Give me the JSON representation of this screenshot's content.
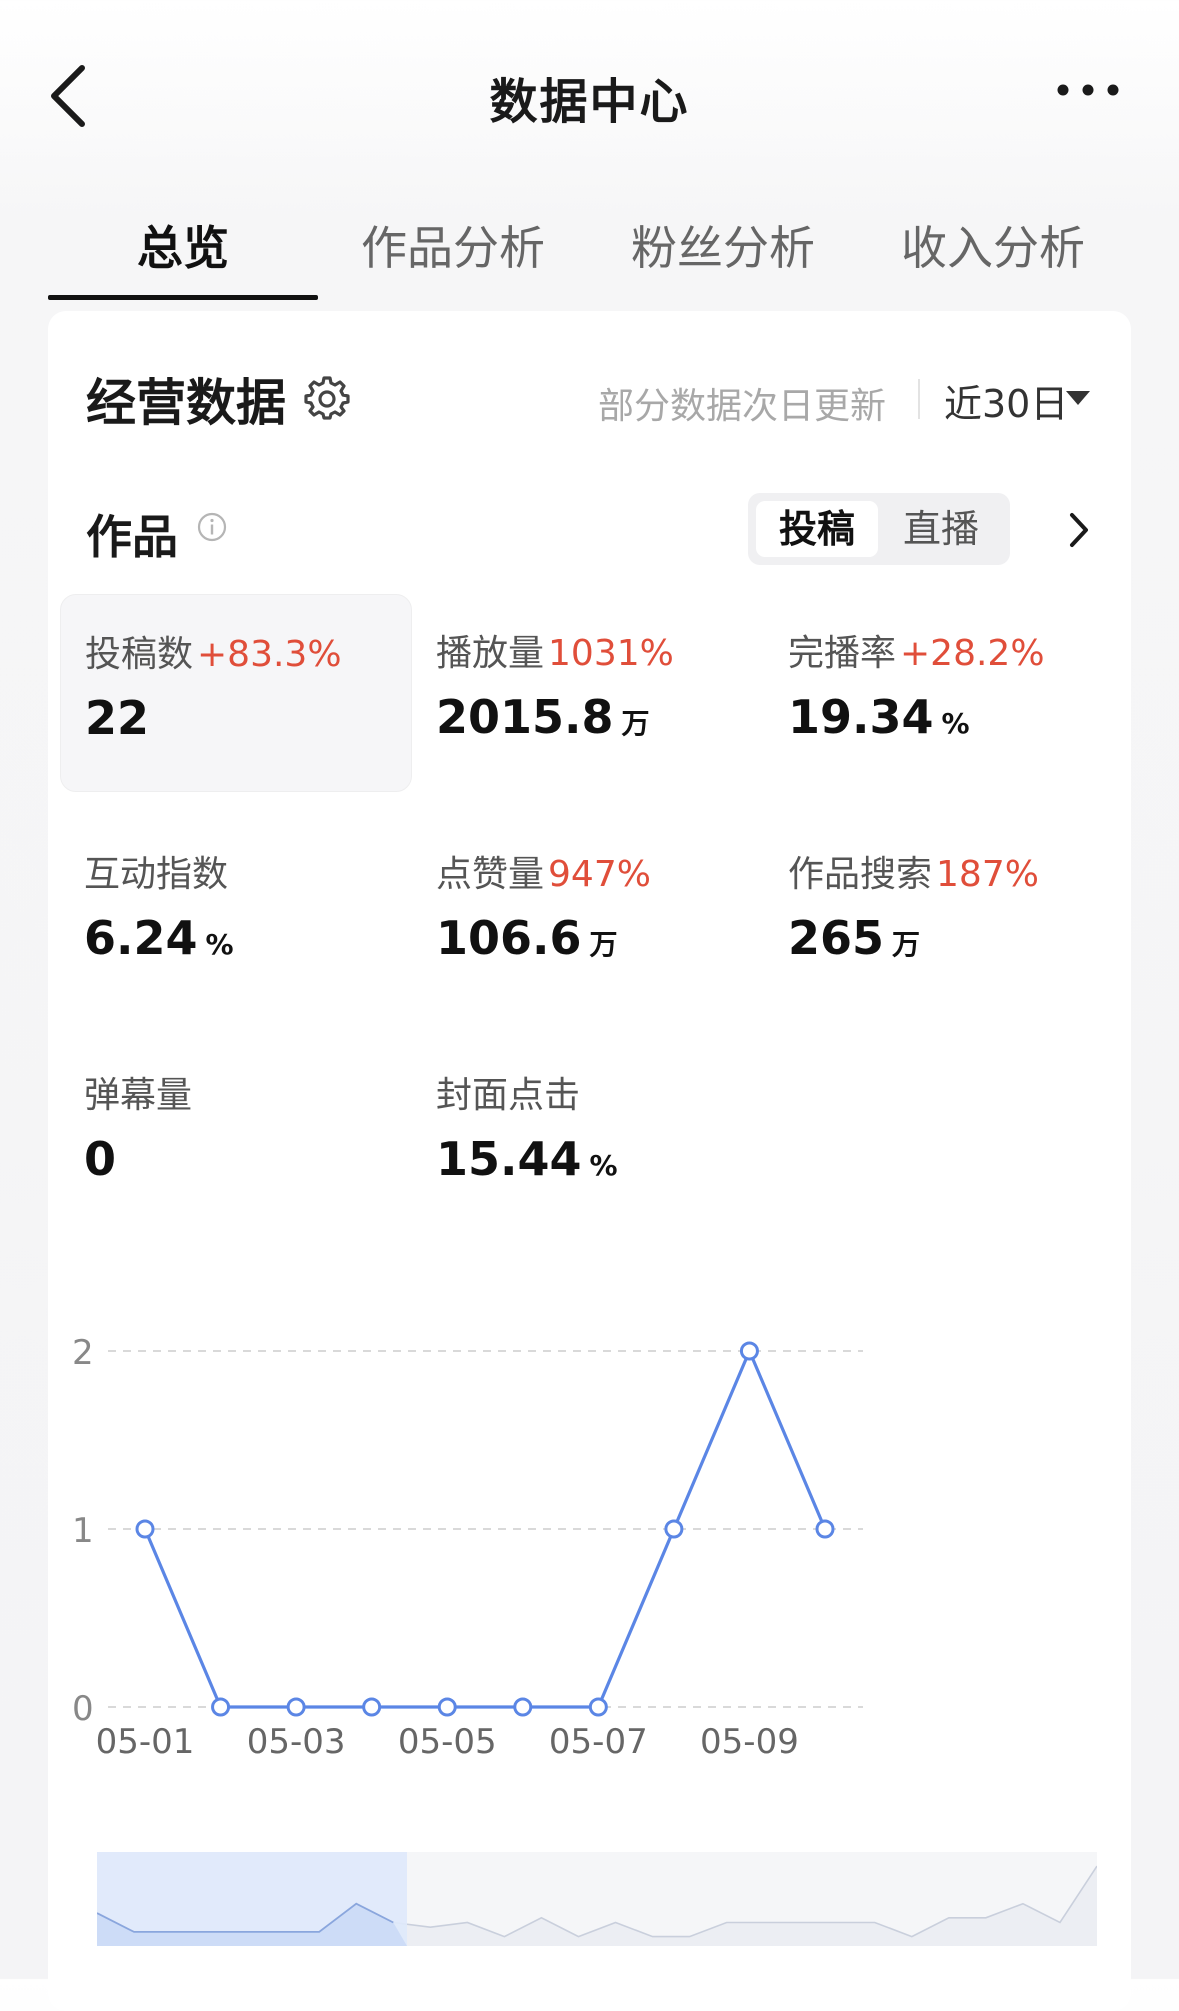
{
  "header": {
    "title": "数据中心",
    "back_icon": "chevron-left-icon",
    "more_icon": "more-dots-icon"
  },
  "tabs": [
    {
      "label": "总览",
      "active": true
    },
    {
      "label": "作品分析",
      "active": false
    },
    {
      "label": "粉丝分析",
      "active": false
    },
    {
      "label": "收入分析",
      "active": false
    }
  ],
  "section": {
    "title": "经营数据",
    "settings_icon": "gear-icon",
    "update_note": "部分数据次日更新",
    "range_label": "近30日",
    "range_icon": "caret-down-icon"
  },
  "works": {
    "label": "作品",
    "info_icon": "info-icon",
    "segments": [
      "投稿",
      "直播"
    ],
    "selected_segment": "投稿",
    "next_icon": "chevron-right-icon"
  },
  "metrics": [
    {
      "label": "投稿数",
      "delta": "+83.3%",
      "value": "22",
      "unit": ""
    },
    {
      "label": "播放量",
      "delta": "1031%",
      "value": "2015.8",
      "unit": "万"
    },
    {
      "label": "完播率",
      "delta": "+28.2%",
      "value": "19.34",
      "unit": "%"
    },
    {
      "label": "互动指数",
      "delta": "",
      "value": "6.24",
      "unit": "%"
    },
    {
      "label": "点赞量",
      "delta": "947%",
      "value": "106.6",
      "unit": "万"
    },
    {
      "label": "作品搜索",
      "delta": "187%",
      "value": "265",
      "unit": "万"
    },
    {
      "label": "弹幕量",
      "delta": "",
      "value": "0",
      "unit": ""
    },
    {
      "label": "封面点击",
      "delta": "",
      "value": "15.44",
      "unit": "%"
    }
  ],
  "chart_data": {
    "type": "line",
    "x": [
      "05-01",
      "05-02",
      "05-03",
      "05-04",
      "05-05",
      "05-06",
      "05-07",
      "05-08",
      "05-09",
      "05-10"
    ],
    "x_tick_labels": [
      "05-01",
      "05-03",
      "05-05",
      "05-07",
      "05-09"
    ],
    "series": [
      {
        "values": [
          1,
          0,
          0,
          0,
          0,
          0,
          0,
          1,
          2,
          1
        ]
      }
    ],
    "y_ticks": [
      "0",
      "1",
      "2"
    ],
    "ylim": [
      0,
      2
    ],
    "grid": true,
    "line_color": "#5b86e5",
    "grid_color": "#d9d9d9"
  },
  "overview_data": {
    "values": [
      0.35,
      0.15,
      0.15,
      0.15,
      0.15,
      0.15,
      0.15,
      0.45,
      0.25,
      0.2,
      0.25,
      0.1,
      0.3,
      0.1,
      0.25,
      0.1,
      0.1,
      0.25,
      0.25,
      0.25,
      0.25,
      0.25,
      0.1,
      0.3,
      0.3,
      0.45,
      0.25,
      0.85
    ],
    "window": [
      0,
      0.31
    ],
    "window_color": "#dfe9fb"
  }
}
